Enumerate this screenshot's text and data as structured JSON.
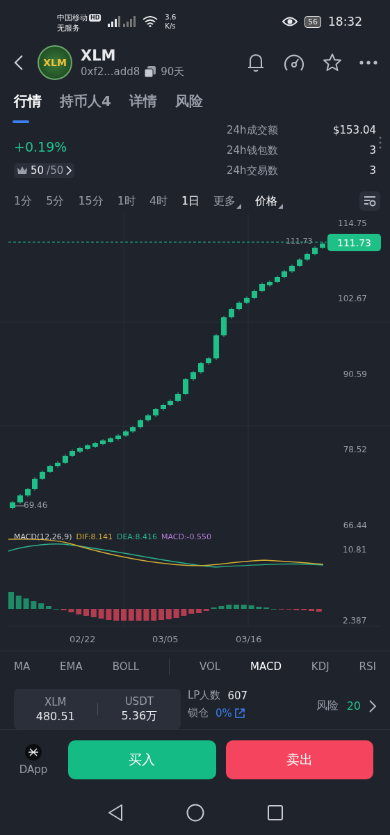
{
  "status_bar": {
    "carrier": "中国移动",
    "hd_badge": "HD",
    "service": "无服务",
    "speed_value": "3.6",
    "speed_unit": "K/s",
    "battery": "56",
    "time": "18:32"
  },
  "header": {
    "logo_text": "XLM",
    "title": "XLM",
    "address": "0xf2...add8",
    "age": "90天"
  },
  "tabs": [
    {
      "label": "行情",
      "selected": true
    },
    {
      "label": "持币人4",
      "selected": false
    },
    {
      "label": "详情",
      "selected": false
    },
    {
      "label": "风险",
      "selected": false
    }
  ],
  "stats": {
    "change": "+0.19%",
    "rank_current": "50",
    "rank_total": "/50",
    "rows": [
      {
        "label": "24h成交额",
        "value": "$153.04"
      },
      {
        "label": "24h钱包数",
        "value": "3"
      },
      {
        "label": "24h交易数",
        "value": "3"
      }
    ]
  },
  "timeframes": [
    {
      "label": "1分",
      "selected": false,
      "kind": "plain"
    },
    {
      "label": "5分",
      "selected": false,
      "kind": "plain"
    },
    {
      "label": "15分",
      "selected": false,
      "kind": "plain"
    },
    {
      "label": "1时",
      "selected": false,
      "kind": "plain"
    },
    {
      "label": "4时",
      "selected": false,
      "kind": "plain"
    },
    {
      "label": "1日",
      "selected": true,
      "kind": "plain"
    },
    {
      "label": "更多",
      "selected": false,
      "kind": "dropdown"
    },
    {
      "label": "价格",
      "selected": true,
      "kind": "dropdown"
    }
  ],
  "chart": {
    "price_ticks": [
      "114.75",
      "102.67",
      "90.59",
      "78.52",
      "66.44"
    ],
    "last_price": "111.73",
    "last_price_tag": "111.73",
    "low_label": "69.46"
  },
  "macd": {
    "legend": [
      {
        "text": "MACD(12,26,9)",
        "color": "#d0d0d0"
      },
      {
        "text": "DIF:8.141",
        "color": "#d2ad35"
      },
      {
        "text": "DEA:8.416",
        "color": "#2bb38c"
      },
      {
        "text": "MACD:-0.550",
        "color": "#b77fd8"
      }
    ],
    "ticks": [
      "10.81",
      "2.387"
    ],
    "dates": [
      "02/22",
      "03/05",
      "03/16"
    ]
  },
  "indicators": [
    {
      "label": "MA",
      "selected": false
    },
    {
      "label": "EMA",
      "selected": false
    },
    {
      "label": "BOLL",
      "selected": false
    },
    {
      "label": "VOL",
      "selected": false
    },
    {
      "label": "MACD",
      "selected": true
    },
    {
      "label": "KDJ",
      "selected": false
    },
    {
      "label": "RSI",
      "selected": false
    }
  ],
  "pool": {
    "tokens": [
      {
        "symbol": "XLM",
        "amount": "480.51"
      },
      {
        "symbol": "USDT",
        "amount": "5.36万"
      }
    ],
    "lp_label": "LP人数",
    "lp_value": "607",
    "lock_label": "锁仓",
    "lock_value": "0%",
    "risk_label": "风险",
    "risk_value": "20"
  },
  "actions": {
    "dapp": "DApp",
    "buy": "买入",
    "sell": "卖出"
  }
}
